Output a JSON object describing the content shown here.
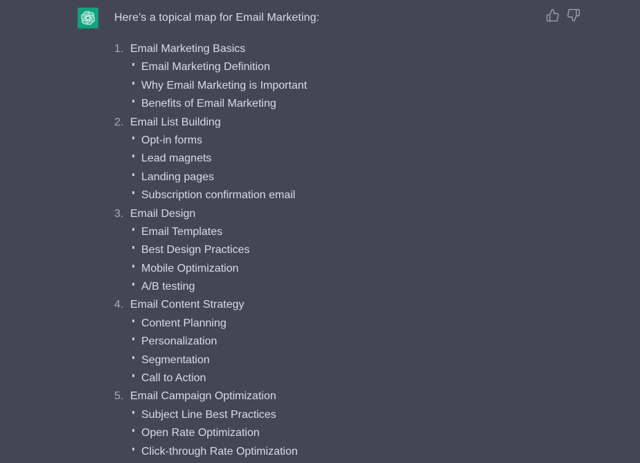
{
  "message": {
    "avatar_icon": "openai-logo-icon",
    "avatar_bg_color": "#10a37f",
    "intro_text": "Here's a topical map for Email Marketing:"
  },
  "feedback": {
    "thumbs_up_icon": "thumbs-up-icon",
    "thumbs_down_icon": "thumbs-down-icon"
  },
  "theme": {
    "background": "#444654",
    "text_color": "#d9dce3",
    "number_color": "#a8adb9",
    "icon_color": "#9ba0ad"
  },
  "topical_map": [
    {
      "number": "1.",
      "title": "Email Marketing Basics",
      "items": [
        "Email Marketing Definition",
        "Why Email Marketing is Important",
        "Benefits of Email Marketing"
      ]
    },
    {
      "number": "2.",
      "title": "Email List Building",
      "items": [
        "Opt-in forms",
        "Lead magnets",
        "Landing pages",
        "Subscription confirmation email"
      ]
    },
    {
      "number": "3.",
      "title": "Email Design",
      "items": [
        "Email Templates",
        "Best Design Practices",
        "Mobile Optimization",
        "A/B testing"
      ]
    },
    {
      "number": "4.",
      "title": "Email Content Strategy",
      "items": [
        "Content Planning",
        "Personalization",
        "Segmentation",
        "Call to Action"
      ]
    },
    {
      "number": "5.",
      "title": "Email Campaign Optimization",
      "items": [
        "Subject Line Best Practices",
        "Open Rate Optimization",
        "Click-through Rate Optimization"
      ]
    }
  ]
}
